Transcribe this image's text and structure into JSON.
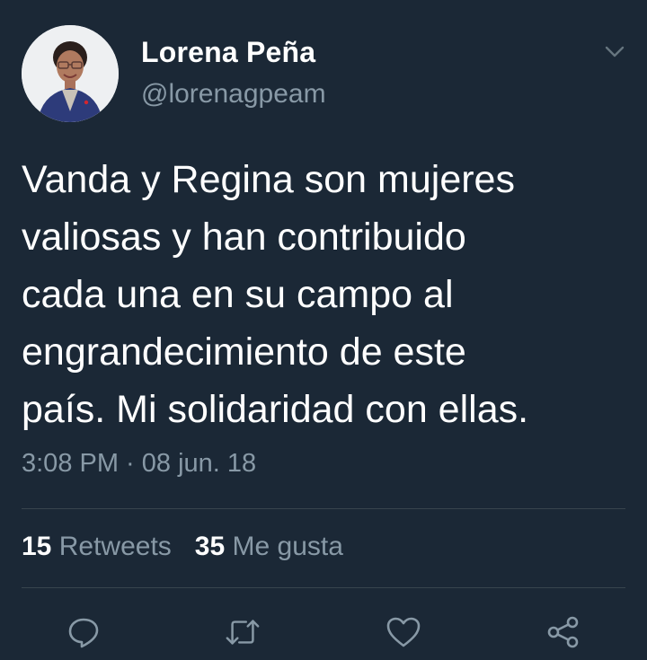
{
  "user": {
    "display_name": "Lorena Peña",
    "handle": "@lorenagpeam"
  },
  "tweet": {
    "lines": [
      "Vanda y Regina son mujeres",
      "valiosas y han contribuido",
      "cada una en su campo al",
      "engrandecimiento de este",
      "país. Mi solidaridad con ellas."
    ],
    "timestamp": "3:08 PM · 08 jun. 18"
  },
  "stats": {
    "retweets_count": "15",
    "retweets_label": "Retweets",
    "likes_count": "35",
    "likes_label": "Me gusta"
  },
  "icons": {
    "caret": "chevron-down-icon",
    "reply": "reply-icon",
    "retweet": "retweet-icon",
    "like": "heart-icon",
    "share": "share-icon"
  },
  "colors": {
    "background": "#1b2836",
    "secondary_text": "#8899a6",
    "primary_text": "#ffffff",
    "divider": "#38444d"
  }
}
